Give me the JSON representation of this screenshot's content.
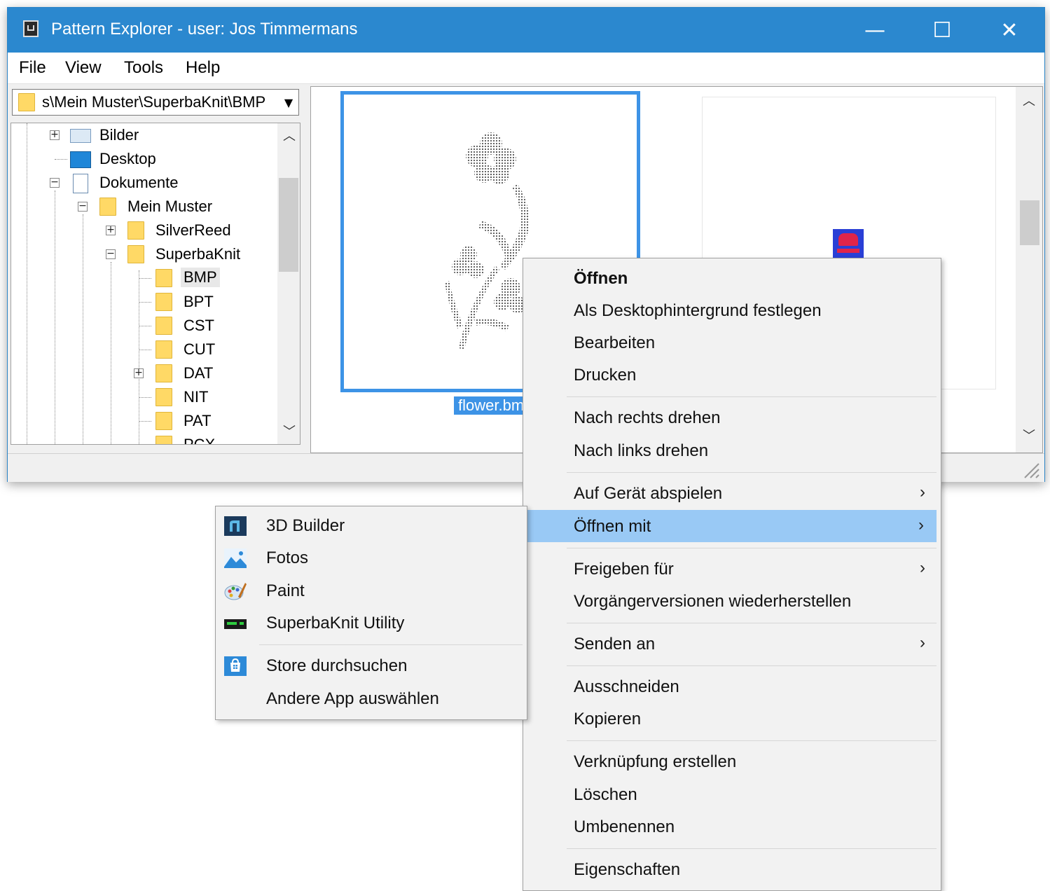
{
  "window": {
    "title": "Pattern Explorer - user: Jos Timmermans",
    "controls": {
      "minimize": "—",
      "maximize": "☐",
      "close": "✕"
    }
  },
  "menubar": [
    "File",
    "View",
    "Tools",
    "Help"
  ],
  "path_combo": {
    "value": "s\\Mein Muster\\SuperbaKnit\\BMP"
  },
  "tree": [
    {
      "label": "Bilder",
      "icon": "pictures-icon",
      "expander": "+"
    },
    {
      "label": "Desktop",
      "icon": "desktop-icon",
      "expander": ""
    },
    {
      "label": "Dokumente",
      "icon": "documents-icon",
      "expander": "−"
    },
    {
      "label": "Mein Muster",
      "icon": "folder-icon",
      "expander": "−"
    },
    {
      "label": "SilverReed",
      "icon": "folder-icon",
      "expander": "+"
    },
    {
      "label": "SuperbaKnit",
      "icon": "folder-icon",
      "expander": "−"
    },
    {
      "label": "BMP",
      "icon": "folder-icon",
      "expander": "",
      "selected": true
    },
    {
      "label": "BPT",
      "icon": "folder-icon",
      "expander": ""
    },
    {
      "label": "CST",
      "icon": "folder-icon",
      "expander": ""
    },
    {
      "label": "CUT",
      "icon": "folder-icon",
      "expander": ""
    },
    {
      "label": "DAT",
      "icon": "folder-icon",
      "expander": "+"
    },
    {
      "label": "NIT",
      "icon": "folder-icon",
      "expander": ""
    },
    {
      "label": "PAT",
      "icon": "folder-icon",
      "expander": ""
    },
    {
      "label": "PCX",
      "icon": "folder-icon",
      "expander": ""
    }
  ],
  "thumbnails": {
    "selected_file": "flower.bmp"
  },
  "context_menu": {
    "items": [
      {
        "label": "Öffnen",
        "bold": true
      },
      {
        "label": "Als Desktophintergrund festlegen"
      },
      {
        "label": "Bearbeiten"
      },
      {
        "label": "Drucken"
      },
      {
        "label": "Nach rechts drehen"
      },
      {
        "label": "Nach links drehen"
      },
      {
        "label": "Auf Gerät abspielen",
        "submenu": true
      },
      {
        "label": "Öffnen mit",
        "submenu": true,
        "highlighted": true
      },
      {
        "label": "Freigeben für",
        "submenu": true
      },
      {
        "label": "Vorgängerversionen wiederherstellen"
      },
      {
        "label": "Senden an",
        "submenu": true
      },
      {
        "label": "Ausschneiden"
      },
      {
        "label": "Kopieren"
      },
      {
        "label": "Verknüpfung erstellen"
      },
      {
        "label": "Löschen"
      },
      {
        "label": "Umbenennen"
      },
      {
        "label": "Eigenschaften"
      }
    ],
    "submenu_arrow": "›"
  },
  "open_with_menu": {
    "items": [
      {
        "label": "3D Builder",
        "icon": "3d-builder-icon"
      },
      {
        "label": "Fotos",
        "icon": "photos-icon"
      },
      {
        "label": "Paint",
        "icon": "paint-icon"
      },
      {
        "label": "SuperbaKnit Utility",
        "icon": "superbaknit-icon"
      },
      {
        "label": "Store durchsuchen",
        "icon": "store-icon"
      },
      {
        "label": "Andere App auswählen",
        "icon": ""
      }
    ]
  },
  "colors": {
    "titlebar": "#2b88cf",
    "selection": "#3d93e6",
    "menu_highlight": "#99c9f5"
  }
}
